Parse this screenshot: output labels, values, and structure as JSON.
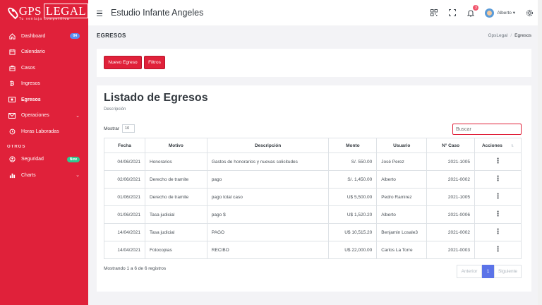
{
  "logo": {
    "main": "GPS",
    "box": "LEGAL",
    "tagline": "Tu ventaja competitiva"
  },
  "sidebar": {
    "items": [
      {
        "label": "Dashboard",
        "icon": "home-icon",
        "badge": "04"
      },
      {
        "label": "Calendario",
        "icon": "calendar-icon"
      },
      {
        "label": "Casos",
        "icon": "briefcase-icon"
      },
      {
        "label": "Ingresos",
        "icon": "bitcoin-icon"
      },
      {
        "label": "Egresos",
        "icon": "money-icon",
        "active": true
      },
      {
        "label": "Operaciones",
        "icon": "envelope-icon",
        "chevron": "⌄"
      },
      {
        "label": "Horas Laboradas",
        "icon": "history-icon"
      }
    ],
    "section": "OTROS",
    "others": [
      {
        "label": "Seguridad",
        "icon": "lock-icon",
        "badge": "New"
      },
      {
        "label": "Charts",
        "icon": "bar-chart-icon",
        "chevron": "⌄"
      }
    ]
  },
  "topbar": {
    "title": "Estudio Infante Angeles",
    "notifications": "3",
    "user": "Alberto ▾"
  },
  "page": {
    "title": "EGRESOS",
    "breadcrumb": [
      "GpsLegal",
      "Egresos"
    ]
  },
  "actions": {
    "new_button": "Nuevo Egreso",
    "filter_button": "Filtros"
  },
  "list": {
    "title": "Listado de Egresos",
    "subtitle": "Descripción",
    "show_label": "Mostrar",
    "show_value": "10",
    "search_placeholder": "Buscar",
    "columns": [
      "Fecha",
      "Motivo",
      "Descripción",
      "Monto",
      "Usuario",
      "N° Caso",
      "Acciones"
    ],
    "rows": [
      {
        "fecha": "04/06/2021",
        "motivo": "Honorarios",
        "descripcion": "Gastos de honorarios y nuevas solicitudes",
        "monto": "S/. 550.00",
        "usuario": "José Perez",
        "caso": "2021-1005"
      },
      {
        "fecha": "02/06/2021",
        "motivo": "Derecho de tramite",
        "descripcion": "pago",
        "monto": "S/. 1,450.00",
        "usuario": "Alberto",
        "caso": "2021-0002"
      },
      {
        "fecha": "01/06/2021",
        "motivo": "Derecho de tramite",
        "descripcion": "pago total caso",
        "monto": "U$ 5,500.00",
        "usuario": "Pedro Ramirez",
        "caso": "2021-1005"
      },
      {
        "fecha": "01/06/2021",
        "motivo": "Tasa judicial",
        "descripcion": "pago $",
        "monto": "U$ 1,520.20",
        "usuario": "Alberto",
        "caso": "2021-0006"
      },
      {
        "fecha": "14/04/2021",
        "motivo": "Tasa judicial",
        "descripcion": "PAGO",
        "monto": "U$ 10,515.20",
        "usuario": "Benjamin Losale3",
        "caso": "2021-0002"
      },
      {
        "fecha": "14/04/2021",
        "motivo": "Fotocopias",
        "descripcion": "RECIBO",
        "monto": "U$ 22,000.00",
        "usuario": "Carlos La Torre",
        "caso": "2021-0003"
      }
    ],
    "info": "Mostrando 1 a 6 de 6 registros",
    "pager": {
      "prev": "Anterior",
      "current": "1",
      "next": "Siguiente"
    }
  },
  "colors": {
    "brand": "#e0213a",
    "accent": "#5b73e8"
  }
}
